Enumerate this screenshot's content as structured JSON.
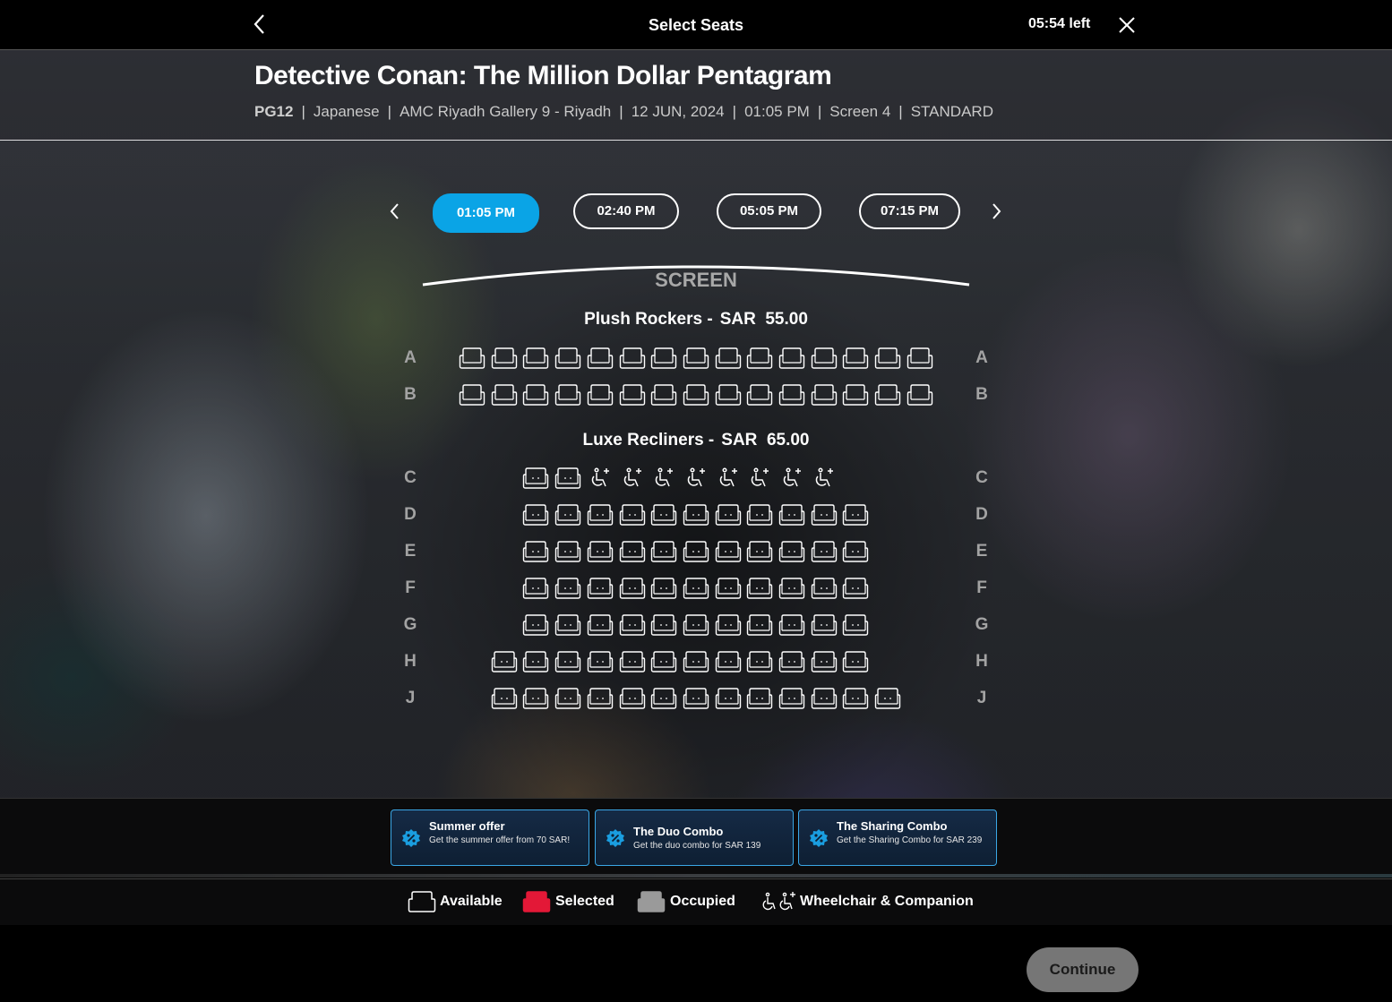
{
  "topbar": {
    "title": "Select Seats",
    "timer": "05:54 left",
    "back_icon": "chevron-left-icon",
    "close_icon": "close-icon"
  },
  "movie": {
    "title": "Detective Conan: The Million Dollar Pentagram",
    "rating": "PG12",
    "language": "Japanese",
    "cinema": "AMC Riyadh Gallery 9 - Riyadh",
    "date": "12 JUN, 2024",
    "time": "01:05 PM",
    "screen": "Screen 4",
    "format": "STANDARD"
  },
  "showtimes": {
    "items": [
      "01:05 PM",
      "02:40 PM",
      "05:05 PM",
      "07:15 PM"
    ],
    "selected": "01:05 PM"
  },
  "screen_label": "SCREEN",
  "sections": [
    {
      "id": "plush",
      "name": "Plush Rockers -",
      "price": "SAR  55.00",
      "rows": [
        {
          "label": "A",
          "seats": "sssssssssssssss",
          "offset": 0
        },
        {
          "label": "B",
          "seats": "sssssssssssssss",
          "offset": 0
        }
      ]
    },
    {
      "id": "luxe",
      "name": "Luxe Recliners -",
      "price": "SAR  65.00",
      "rows": [
        {
          "label": "C",
          "seats": "rrwwwwwwww",
          "offset": 2
        },
        {
          "label": "D",
          "seats": "rrrrrrrrrrr",
          "offset": 2
        },
        {
          "label": "E",
          "seats": "rrrrrrrrrrr",
          "offset": 2
        },
        {
          "label": "F",
          "seats": "rrrrrrrrrrr",
          "offset": 2
        },
        {
          "label": "G",
          "seats": "rrrrrrrrrrr",
          "offset": 2
        },
        {
          "label": "H",
          "seats": "rrrrrrrrrrrr",
          "offset": 1
        },
        {
          "label": "J",
          "seats": "rrrrrrrrrrrrr",
          "offset": 1
        }
      ]
    }
  ],
  "offers": [
    {
      "title": "Summer offer",
      "desc": "Get the summer offer from 70 SAR!",
      "icon": "discount-icon"
    },
    {
      "title": "The Duo Combo",
      "desc": "Get the duo combo for SAR 139",
      "icon": "discount-icon"
    },
    {
      "title": "The Sharing Combo",
      "desc": "Get the Sharing Combo for SAR 239",
      "icon": "discount-icon"
    }
  ],
  "legend": {
    "available": "Available",
    "selected": "Selected",
    "occupied": "Occupied",
    "wheelchair": "Wheelchair & Companion"
  },
  "colors": {
    "accent": "#0aa4e6",
    "selected_seat": "#e31837",
    "occupied_seat": "#9a9a9a",
    "offer_border": "#3aa7e6"
  },
  "continue_label": "Continue"
}
